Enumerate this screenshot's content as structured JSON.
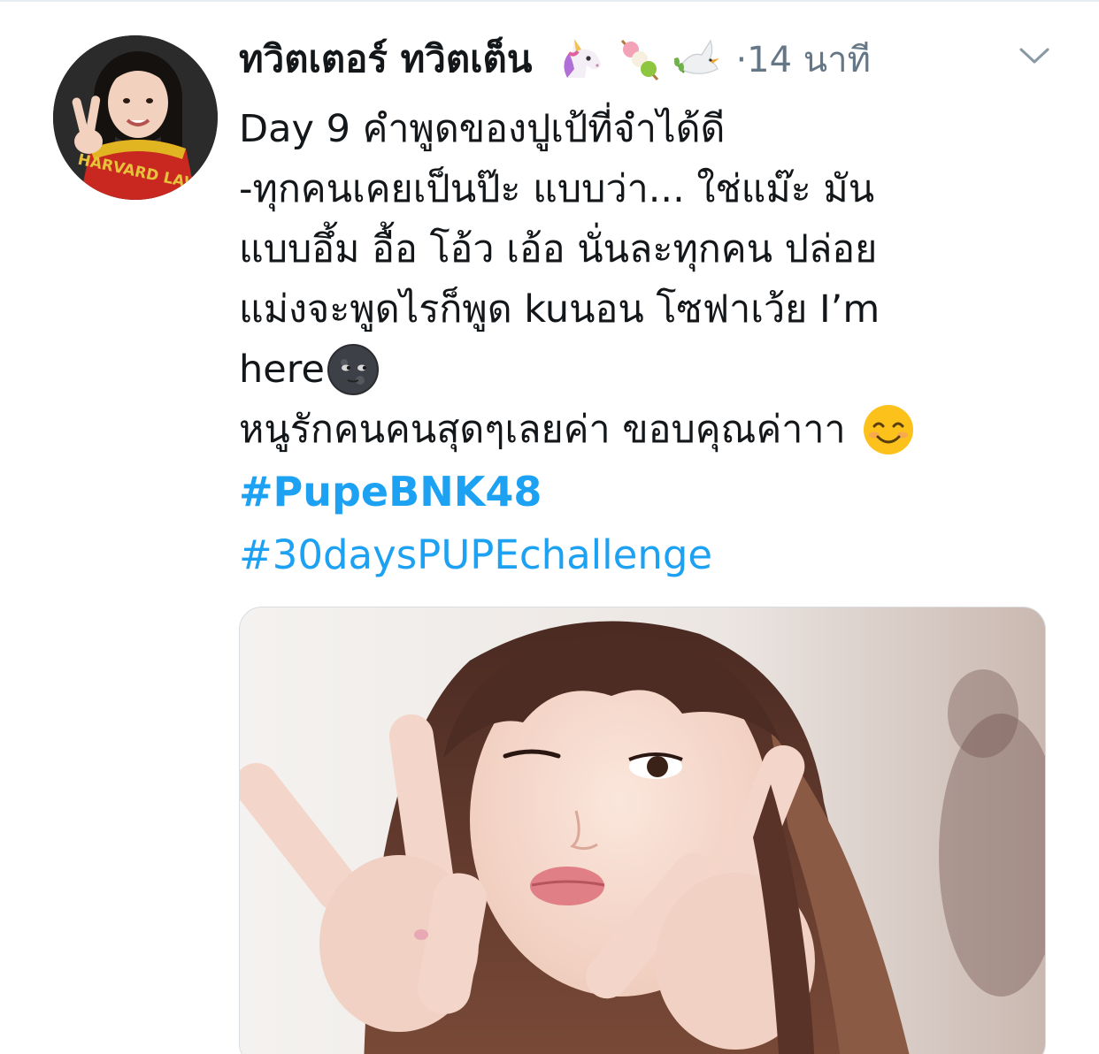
{
  "tweet": {
    "author": {
      "display_name": "ทวิตเตอร์ ทวิตเต็น",
      "name_emojis": [
        "unicorn-emoji",
        "dango-emoji",
        "dove-emoji"
      ],
      "avatar_shirt_text": "HARVARD LAW"
    },
    "timestamp": "·14 นาที",
    "menu_icon": "chevron-down-icon",
    "text_lines": [
      "Day 9 คำพูดของปูเป้ที่จำได้ดี",
      "-ทุกคนเคยเป็นป๊ะ แบบว่า... ใช่แม๊ะ มัน",
      "แบบอึ้ม อื้อ โอ้ว เอ้อ นั่นละทุกคน ปล่อย",
      "แม่งจะพูดไรก็พูด kuนอน โซฟาเว้ย I’m",
      "here",
      "หนูรักคนคนสุดๆเลยค่า ขอบคุณค่าาา"
    ],
    "inline_emojis": [
      "new-moon-face-emoji",
      "smiling-face-emoji"
    ],
    "hashtags": [
      "#PupeBNK48",
      "#30daysPUPEchallenge"
    ],
    "media": {
      "type": "photo",
      "subject": "girl-peace-sign-photo"
    }
  },
  "colors": {
    "link": "#1da1f2",
    "secondary_text": "#657786",
    "primary_text": "#14171a",
    "background": "#ffffff"
  }
}
